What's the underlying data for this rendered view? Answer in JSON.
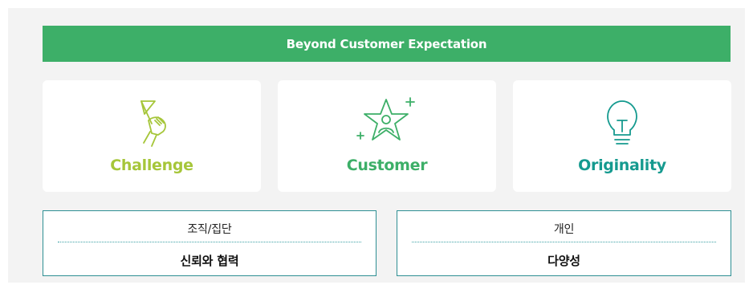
{
  "banner": {
    "text": "Beyond Customer Expectation"
  },
  "values": [
    {
      "label": "Challenge",
      "icon": "flag-hand-icon",
      "color": "#a6c63a"
    },
    {
      "label": "Customer",
      "icon": "star-person-icon",
      "color": "#3daf68"
    },
    {
      "label": "Originality",
      "icon": "light-bulb-icon",
      "color": "#159a8f"
    }
  ],
  "groups": [
    {
      "title": "조직/집단",
      "value": "신뢰와 협력"
    },
    {
      "title": "개인",
      "value": "다양성"
    }
  ],
  "colors": {
    "banner": "#3daf68",
    "border": "#2e8f93",
    "panel": "#f3f3f3"
  }
}
